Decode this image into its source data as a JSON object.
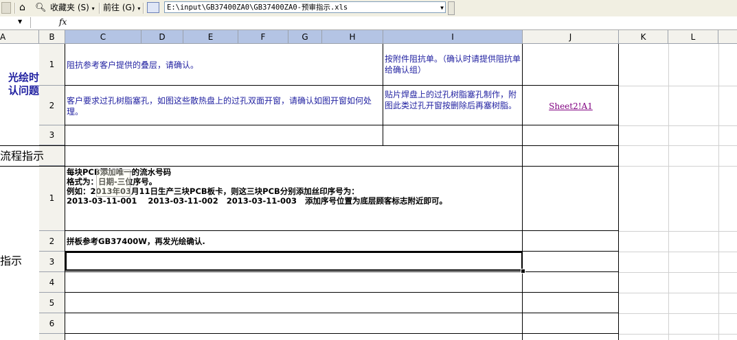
{
  "toolbar": {
    "favorites": "收藏夹",
    "favorites_key": "(S)",
    "goto": "前往",
    "goto_key": "(G)",
    "address": "E:\\input\\GB37400ZA0\\GB37400ZA0-预审指示.xls"
  },
  "formula": {
    "fx": "fx"
  },
  "columns": [
    "A",
    "B",
    "C",
    "D",
    "E",
    "F",
    "G",
    "H",
    "I",
    "J",
    "K",
    "L"
  ],
  "sections": {
    "s1": {
      "title_line1": "光绘时",
      "title_line2": "认问题",
      "color": "#1f1fa0"
    },
    "s2": {
      "title": "流程指示"
    },
    "s3": {
      "title": "指示"
    }
  },
  "rows": {
    "r1": {
      "num": "1",
      "question": "阻抗参考客户提供的叠层，请确认。",
      "answer": "按附件阻抗单。（确认时请提供阻抗单给确认组）"
    },
    "r2": {
      "num": "2",
      "question": "客户要求过孔树脂塞孔，如图这些散热盘上的过孔双面开窗，请确认如图开窗如何处理。",
      "answer": "贴片焊盘上的过孔树脂塞孔制作，附图此类过孔开窗按删除后再塞树脂。",
      "link": "Sheet2!A1"
    },
    "r3": {
      "num": "3"
    },
    "f1": {
      "num": "1",
      "line1": "每块PCB添加唯一的流水号码",
      "line2": "格式为：日期-三位序号。",
      "line3": "例如：2013年03月11日生产三块PCB板卡，则这三块PCB分别添加丝印序号为：",
      "line4": "2013-03-11-001    2013-03-11-002   2013-03-11-003   添加序号位置为底层顾客标志附近即可。"
    },
    "f2": {
      "num": "2",
      "text": "拼板参考GB37400W，再发光绘确认."
    },
    "f3": {
      "num": "3"
    },
    "f4": {
      "num": "4"
    },
    "f5": {
      "num": "5"
    },
    "f6": {
      "num": "6"
    }
  }
}
